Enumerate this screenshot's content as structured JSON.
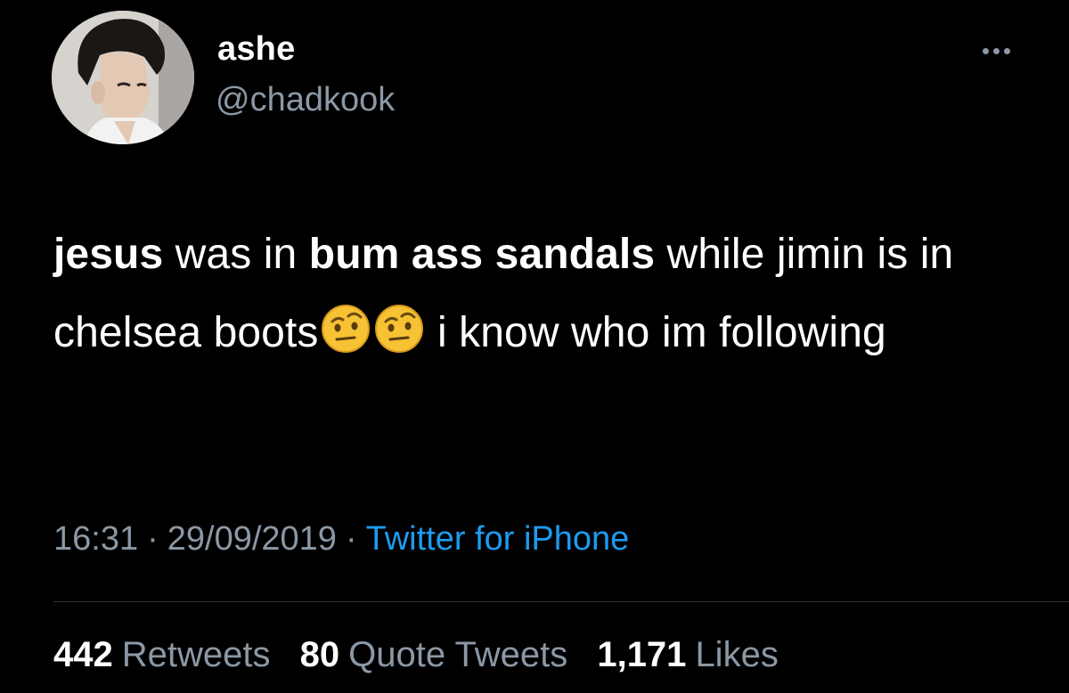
{
  "author": {
    "display_name": "ashe",
    "handle": "@chadkook",
    "avatar_icon": "profile-photo"
  },
  "menu": {
    "icon": "more-horizontal-icon"
  },
  "tweet": {
    "segments": [
      {
        "text": "jesus",
        "bold": true
      },
      {
        "text": " was in ",
        "bold": false
      },
      {
        "text": "bum ass sandals",
        "bold": true
      },
      {
        "text": " while jimin is in chelsea boots",
        "bold": false
      },
      {
        "emoji": "face-with-raised-eyebrow"
      },
      {
        "emoji": "face-with-raised-eyebrow"
      },
      {
        "text": " i know who im following",
        "bold": false
      }
    ]
  },
  "meta": {
    "time": "16:31",
    "separator": "·",
    "date": "29/09/2019",
    "source": "Twitter for iPhone"
  },
  "stats": {
    "retweets_count": "442",
    "retweets_label": "Retweets",
    "quotes_count": "80",
    "quotes_label": "Quote Tweets",
    "likes_count": "1,171",
    "likes_label": "Likes"
  },
  "colors": {
    "background": "#000000",
    "primary_text": "#ffffff",
    "secondary_text": "#8b98a5",
    "link": "#1d9bf0",
    "divider": "#2f3336",
    "emoji_face": "#f7c233"
  }
}
